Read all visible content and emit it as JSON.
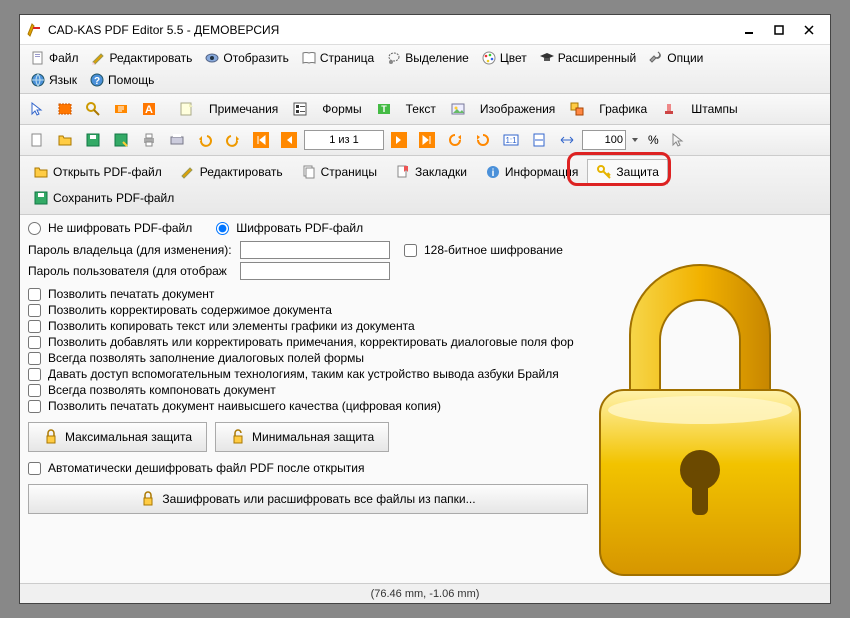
{
  "window": {
    "title": "CAD-KAS PDF Editor 5.5 - ДЕМОВЕРСИЯ"
  },
  "menu": {
    "file": "Файл",
    "edit": "Редактировать",
    "view": "Отобразить",
    "page": "Страница",
    "select": "Выделение",
    "color": "Цвет",
    "advanced": "Расширенный",
    "options": "Опции",
    "lang": "Язык",
    "help": "Помощь"
  },
  "toolbar2": {
    "annotations": "Примечания",
    "forms": "Формы",
    "text": "Текст",
    "images": "Изображения",
    "graphics": "Графика",
    "stamps": "Штампы"
  },
  "nav": {
    "page_of": "1 из 1",
    "zoom": "100",
    "percent": "%"
  },
  "tabs": {
    "open": "Открыть PDF-файл",
    "edit": "Редактировать",
    "pages": "Страницы",
    "bookmarks": "Закладки",
    "info": "Информация",
    "security": "Защита",
    "save": "Сохранить PDF-файл"
  },
  "security": {
    "radio_no_encrypt": "Не шифровать PDF-файл",
    "radio_encrypt": "Шифровать PDF-файл",
    "owner_pw_label": "Пароль владельца (для изменения):",
    "user_pw_label": "Пароль пользователя (для отображ",
    "bit128": "128-битное шифрование",
    "perm_print": "Позволить печатать документ",
    "perm_edit": "Позволить корректировать содержимое документа",
    "perm_copy": "Позволить копировать текст или элементы графики из документа",
    "perm_annot": "Позволить добавлять или корректировать примечания, корректировать диалоговые поля фор",
    "perm_form": "Всегда позволять заполнение диалоговых полей формы",
    "perm_acc": "Давать доступ вспомогательным технологиям, таким как устройство вывода азбуки Брайля",
    "perm_assemble": "Всегда позволять компоновать документ",
    "perm_hq_print": "Позволить печатать документ наивысшего качества (цифровая копия)",
    "btn_max": "Максимальная защита",
    "btn_min": "Минимальная защита",
    "auto_decrypt": "Автоматически дешифровать файл PDF после открытия",
    "btn_batch": "Зашифровать или расшифровать все файлы из папки..."
  },
  "status": {
    "coords": "(76.46 mm, -1.06 mm)"
  }
}
